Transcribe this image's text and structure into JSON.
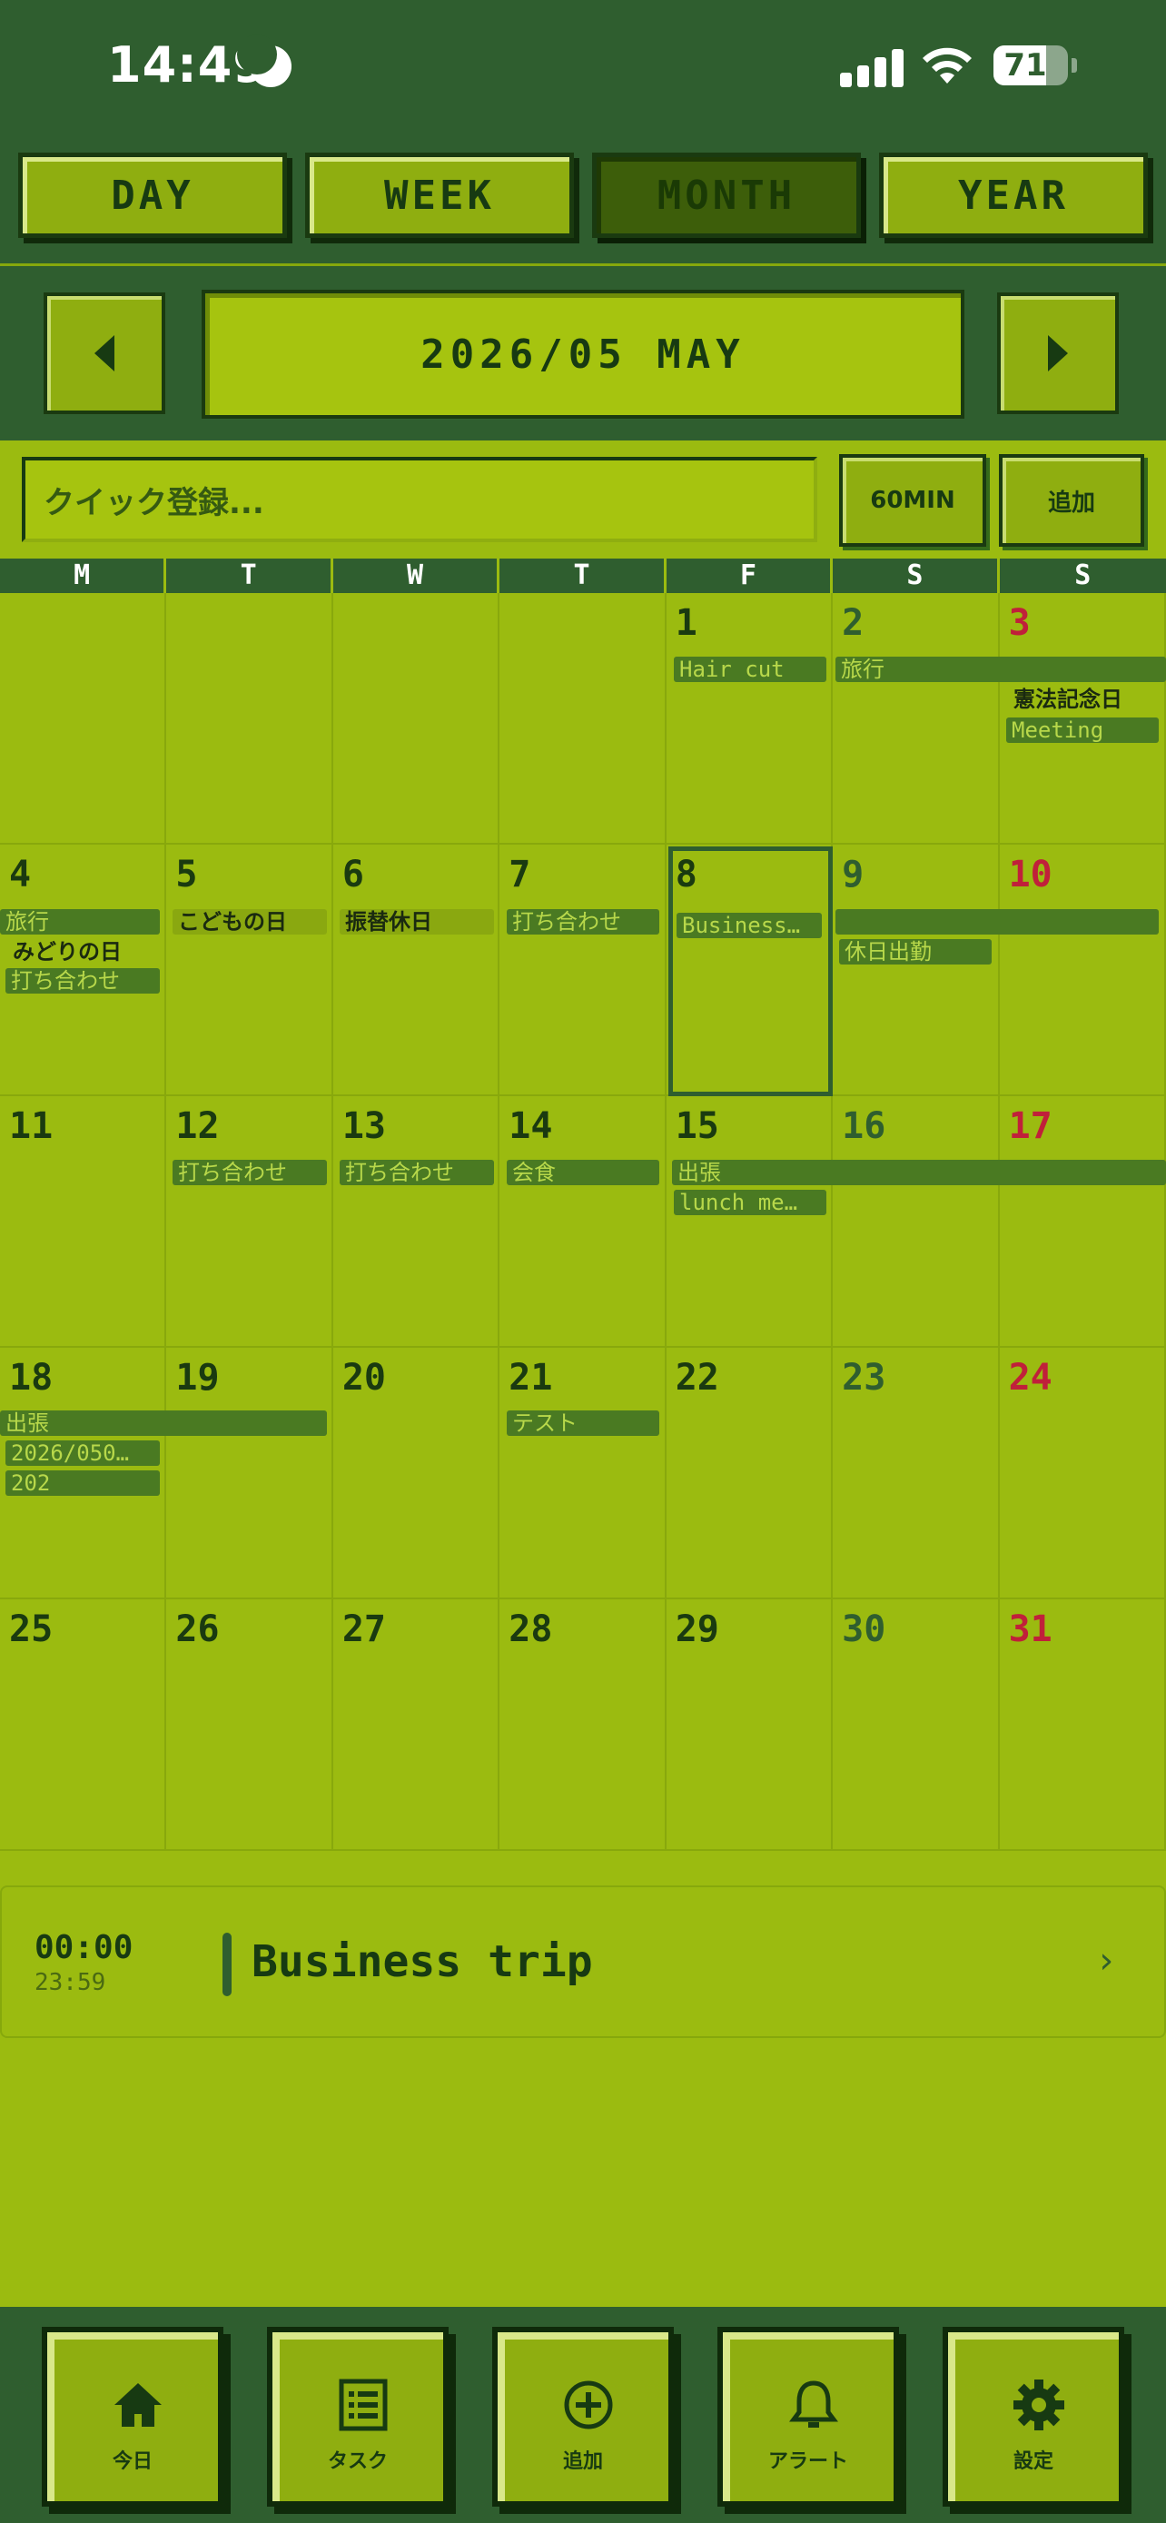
{
  "status": {
    "time": "14:49",
    "battery": "71",
    "battery_level": 0.71
  },
  "tabs": [
    {
      "label": "DAY",
      "active": false
    },
    {
      "label": "WEEK",
      "active": false
    },
    {
      "label": "MONTH",
      "active": true
    },
    {
      "label": "YEAR",
      "active": false
    }
  ],
  "month_nav": {
    "label": "2026/05 MAY"
  },
  "quick_add": {
    "placeholder": "クイック登録...",
    "duration_label": "60MIN",
    "add_label": "追加"
  },
  "weekdays": [
    "M",
    "T",
    "W",
    "T",
    "F",
    "S",
    "S"
  ],
  "calendar": {
    "today": 8,
    "days": [
      "",
      "",
      "",
      "",
      "1",
      "2",
      "3",
      "4",
      "5",
      "6",
      "7",
      "8",
      "9",
      "10",
      "11",
      "12",
      "13",
      "14",
      "15",
      "16",
      "17",
      "18",
      "19",
      "20",
      "21",
      "22",
      "23",
      "24",
      "25",
      "26",
      "27",
      "28",
      "29",
      "30",
      "31"
    ],
    "events": {
      "hair_cut": "Hair cut",
      "trip_1": "旅行",
      "constitution_day": "憲法記念日",
      "meeting": "Meeting",
      "trip_2": "旅行",
      "greenery_day": "みどりの日",
      "uchiawase_4": "打ち合わせ",
      "childrens_day": "こどもの日",
      "substitute_holiday": "振替休日",
      "uchiawase_7": "打ち合わせ",
      "business_8": "Business…",
      "holiday_work": "休日出勤",
      "uchiawase_12": "打ち合わせ",
      "uchiawase_13": "打ち合わせ",
      "kaishoku": "会食",
      "shucho_15": "出張",
      "lunch_meeting": "lunch me…",
      "shucho_18": "出張",
      "dated_event": "2026/050…",
      "event_202": "202",
      "test": "テスト"
    }
  },
  "detail": {
    "start": "00:00",
    "end": "23:59",
    "title": "Business trip",
    "chevron": "›"
  },
  "bottom_nav": [
    {
      "label": "今日",
      "icon": "home-icon"
    },
    {
      "label": "タスク",
      "icon": "list-icon"
    },
    {
      "label": "追加",
      "icon": "plus-circle-icon"
    },
    {
      "label": "アラート",
      "icon": "bell-icon"
    },
    {
      "label": "設定",
      "icon": "gear-icon"
    }
  ],
  "colors": {
    "background": "#9bbb10",
    "header": "#2f5e2f",
    "event": "#4a7a22",
    "sunday": "#c0203a"
  }
}
